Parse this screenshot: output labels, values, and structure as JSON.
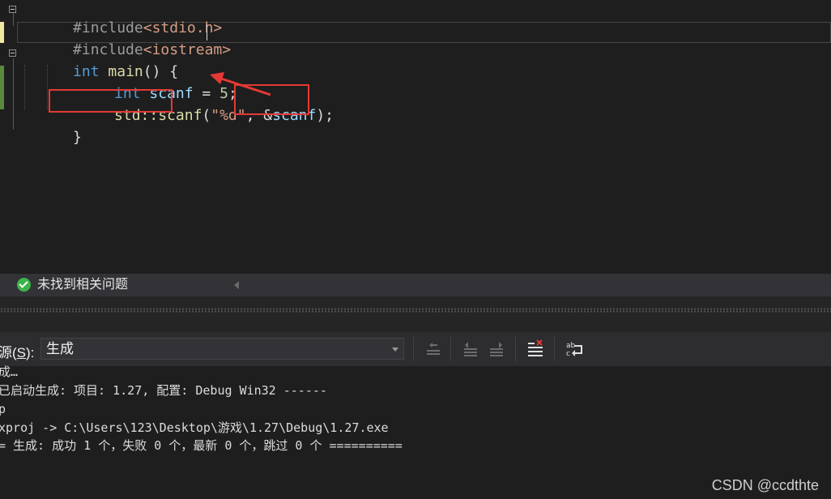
{
  "editor": {
    "line1": {
      "directive": "#include",
      "header": "<stdio.h>"
    },
    "line2": {
      "directive": "#include",
      "header": "<iostream>"
    },
    "line3": {
      "type": "int",
      "func": "main",
      "rest": "() {"
    },
    "line4": {
      "type": "int",
      "var": "scanf",
      "op": " = ",
      "num": "5",
      "end": ";"
    },
    "line5": {
      "ns": "std::scanf",
      "paren": "(",
      "str": "\"%d\"",
      "comma": ", ",
      "amp": "&",
      "arg": "scanf",
      "end": ");"
    },
    "line6": {
      "brace": "}"
    }
  },
  "status": {
    "message": "未找到相关问题"
  },
  "toolbar": {
    "source_prefix": "源(",
    "source_key": "S",
    "source_suffix": "):",
    "source_value": "生成",
    "btn_prev_label": "上一个",
    "btn_next_label": "下一个"
  },
  "output": {
    "lines": [
      "成…",
      "已启动生成: 项目: 1.27, 配置: Debug Win32 ------",
      "p",
      "xproj -> C:\\Users\\123\\Desktop\\游戏\\1.27\\Debug\\1.27.exe",
      "= 生成: 成功 1 个，失败 0 个，最新 0 个，跳过 0 个 =========="
    ]
  },
  "watermark": "CSDN @ccdthte",
  "colors": {
    "keyword": "#569cd6",
    "function": "#dcdcaa",
    "variable": "#9cdcfe",
    "string": "#d69d85",
    "number": "#b5cea8",
    "annotation_red": "#e53935",
    "change_bar_yellow": "#efe6a0",
    "change_bar_green": "#58893c"
  }
}
